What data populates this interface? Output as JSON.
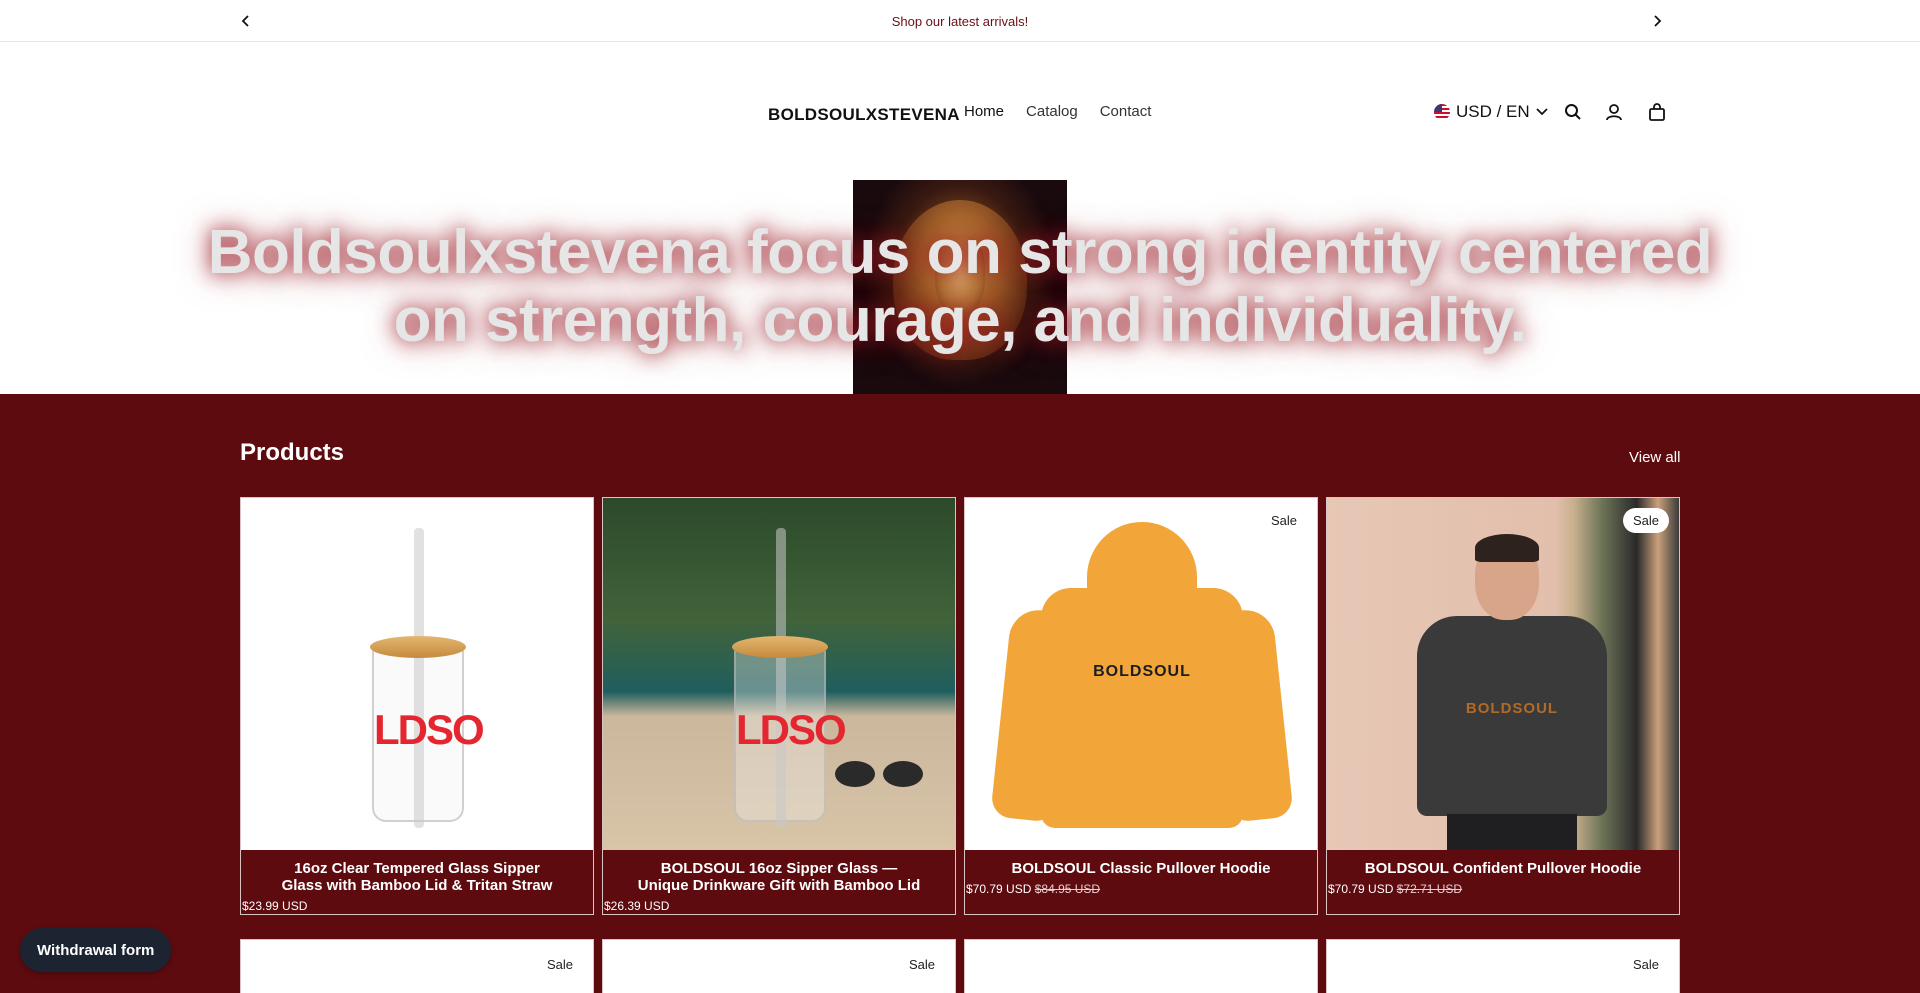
{
  "announcement": {
    "message": "Shop our latest arrivals!",
    "prev_icon": "chevron-left-icon",
    "next_icon": "chevron-right-icon"
  },
  "header": {
    "brand": "BOLDSOULXSTEVENA",
    "nav": [
      {
        "label": "Home"
      },
      {
        "label": "Catalog"
      },
      {
        "label": "Contact"
      }
    ],
    "locale": "USD / EN",
    "icons": [
      "search-icon",
      "account-icon",
      "cart-icon"
    ]
  },
  "hero": {
    "headline_line1": "Boldsoulxstevena focus on strong identity centered",
    "headline_line2": "on strength, courage, and individuality."
  },
  "products": {
    "heading": "Products",
    "view_all": "View all",
    "items": [
      {
        "title_line1": "16oz Clear Tempered Glass Sipper",
        "title_line2": "Glass with Bamboo Lid & Tritan Straw",
        "price": "$23.99 USD",
        "compare_price": "",
        "sale": false
      },
      {
        "title_line1": "BOLDSOUL 16oz Sipper Glass —",
        "title_line2": "Unique Drinkware Gift with Bamboo Lid",
        "price": "$26.39 USD",
        "compare_price": "",
        "sale": false
      },
      {
        "title_line1": "BOLDSOUL Classic Pullover Hoodie",
        "title_line2": "",
        "price": "$70.79 USD",
        "compare_price": "$84.95 USD",
        "sale": true,
        "badge": "Sale"
      },
      {
        "title_line1": "BOLDSOUL Confident Pullover Hoodie",
        "title_line2": "",
        "price": "$70.79 USD",
        "compare_price": "$72.71 USD",
        "sale": true,
        "badge": "Sale"
      }
    ],
    "row2_badges": [
      "Sale",
      "Sale",
      "",
      "Sale"
    ],
    "print_text_glass": "LDSO",
    "print_text_hoodie": "BOLDSOUL"
  },
  "withdrawal": {
    "label": "Withdrawal form"
  },
  "colors": {
    "brand_maroon": "#5e0b0f",
    "announce_text": "#6b0f14",
    "withdraw_bg": "#1b2430"
  }
}
